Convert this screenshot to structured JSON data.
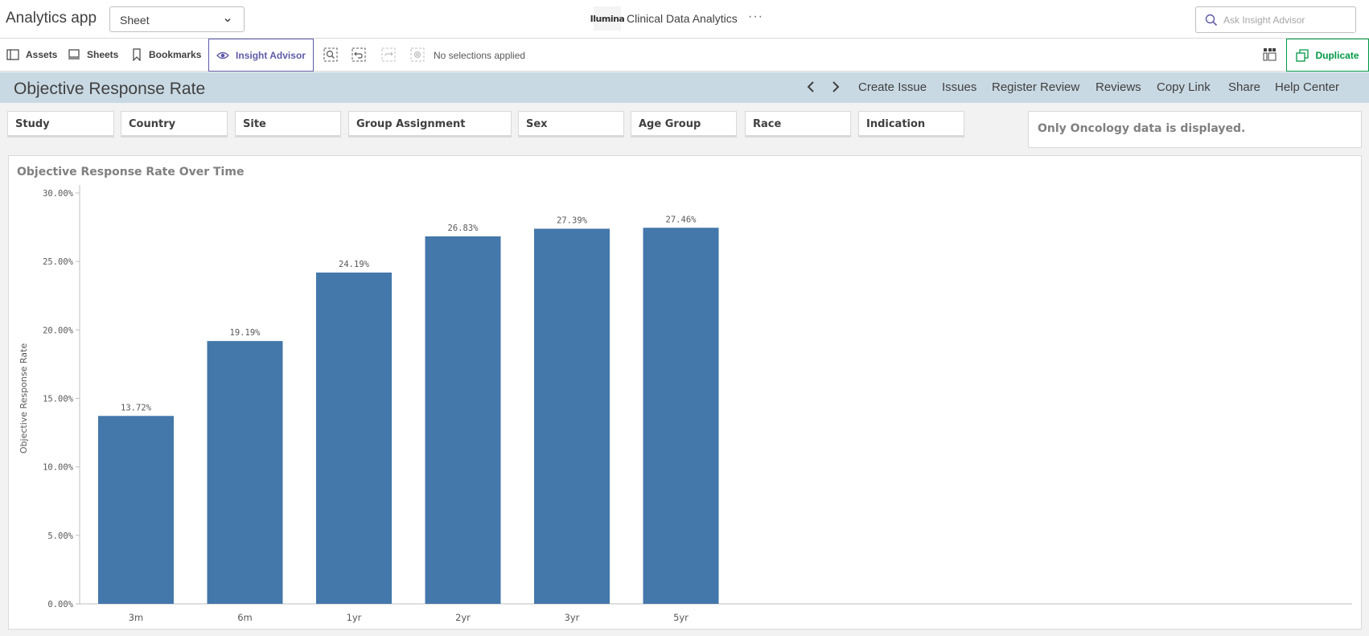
{
  "app": {
    "title": "Analytics app",
    "sheet_select_value": "Sheet",
    "center_title": "Clinical Data Analytics",
    "logo_text": "Ilumina",
    "ask_placeholder": "Ask Insight Advisor"
  },
  "toolbar": {
    "assets": "Assets",
    "sheets": "Sheets",
    "bookmarks": "Bookmarks",
    "insight_advisor": "Insight Advisor",
    "no_selections": "No selections applied",
    "duplicate": "Duplicate"
  },
  "sheet_header": {
    "title": "Objective Response Rate",
    "links": [
      "Create Issue",
      "Issues",
      "Register Review",
      "Reviews",
      "Copy Link",
      "Share",
      "Help Center"
    ]
  },
  "filters": [
    "Study",
    "Country",
    "Site",
    "Group Assignment",
    "Sex",
    "Age Group",
    "Race",
    "Indication"
  ],
  "notice": "Only Oncology data is displayed.",
  "colors": {
    "bar": "#4477aa",
    "header_band": "#c9d9e3",
    "insight_accent": "#5f5ba8",
    "duplicate_accent": "#009845"
  },
  "chart_data": {
    "type": "bar",
    "title": "Objective Response Rate Over Time",
    "ylabel": "Objective Response Rate",
    "xlabel": "",
    "categories": [
      "3m",
      "6m",
      "1yr",
      "2yr",
      "3yr",
      "5yr"
    ],
    "values": [
      13.72,
      19.19,
      24.19,
      26.83,
      27.39,
      27.46
    ],
    "value_labels": [
      "13.72%",
      "19.19%",
      "24.19%",
      "26.83%",
      "27.39%",
      "27.46%"
    ],
    "ylim": [
      0,
      30
    ],
    "y_ticks": [
      0,
      5,
      10,
      15,
      20,
      25,
      30
    ],
    "y_tick_labels": [
      "0.00%",
      "5.00%",
      "10.00%",
      "15.00%",
      "20.00%",
      "25.00%",
      "30.00%"
    ],
    "grid": false,
    "legend": "none"
  }
}
